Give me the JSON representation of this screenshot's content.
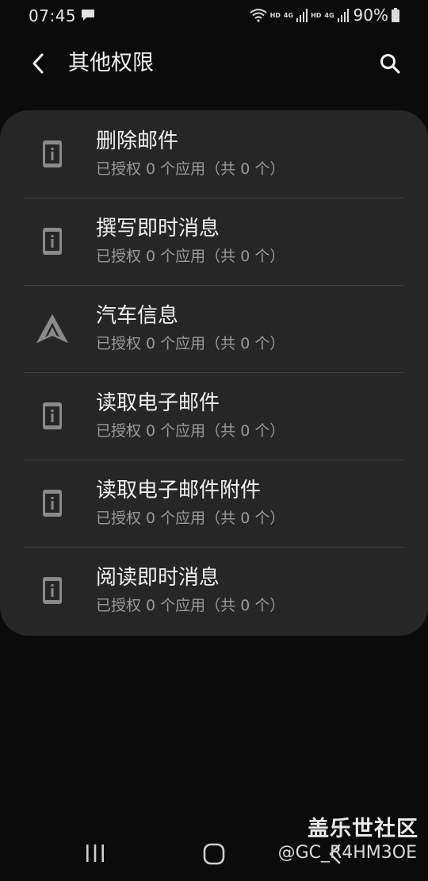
{
  "status_bar": {
    "time": "07:45",
    "hd1": "HD",
    "net1": "4G",
    "hd2": "HD",
    "net2": "4G",
    "battery": "90%"
  },
  "header": {
    "title": "其他权限"
  },
  "permissions": [
    {
      "title": "删除邮件",
      "subtitle": "已授权 0 个应用（共 0 个）",
      "icon": "device-info-icon"
    },
    {
      "title": "撰写即时消息",
      "subtitle": "已授权 0 个应用（共 0 个）",
      "icon": "device-info-icon"
    },
    {
      "title": "汽车信息",
      "subtitle": "已授权 0 个应用（共 0 个）",
      "icon": "android-auto-icon"
    },
    {
      "title": "读取电子邮件",
      "subtitle": "已授权 0 个应用（共 0 个）",
      "icon": "device-info-icon"
    },
    {
      "title": "读取电子邮件附件",
      "subtitle": "已授权 0 个应用（共 0 个）",
      "icon": "device-info-icon"
    },
    {
      "title": "阅读即时消息",
      "subtitle": "已授权 0 个应用（共 0 个）",
      "icon": "device-info-icon"
    }
  ],
  "watermark": {
    "line1": "盖乐世社区",
    "line2": "@GC_R4HM3OE"
  },
  "colors": {
    "background": "#0b0b0b",
    "card": "#262626",
    "text_primary": "#f0f0f0",
    "text_secondary": "#9a9a9a",
    "icon": "#8a8a8a"
  }
}
